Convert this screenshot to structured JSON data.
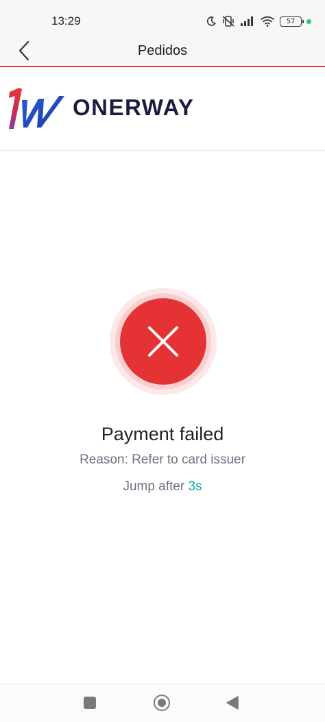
{
  "status_bar": {
    "time": "13:29",
    "battery": "57",
    "icons": [
      "moon-icon",
      "vibrate-off-icon",
      "signal-icon",
      "wifi-icon",
      "battery-icon",
      "green-dot-indicator"
    ]
  },
  "nav_bar": {
    "title": "Pedidos",
    "back_icon": "chevron-left-icon"
  },
  "brand": {
    "name": "ONERWAY",
    "mark_icon": "onerway-logo-icon"
  },
  "result": {
    "status_icon": "close-circle-icon",
    "title": "Payment failed",
    "reason": "Reason: Refer to card issuer",
    "jump_prefix": "Jump after ",
    "countdown": "3s"
  },
  "android_nav": {
    "icons": [
      "recents-square-icon",
      "home-circle-icon",
      "back-triangle-icon"
    ]
  },
  "colors": {
    "accent_red": "#e53335",
    "divider_red": "#e53935",
    "brand_navy": "#1a1d40",
    "countdown_teal": "#1aa3a3"
  }
}
